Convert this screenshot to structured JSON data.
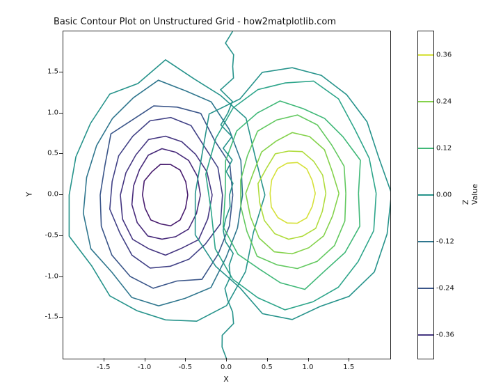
{
  "chart_data": {
    "type": "contour",
    "title": "Basic Contour Plot on Unstructured Grid - how2matplotlib.com",
    "xlabel": "X",
    "ylabel": "Y",
    "xlim": [
      -2.0,
      2.0
    ],
    "ylim": [
      -2.0,
      2.0
    ],
    "xticks": [
      -1.5,
      -1.0,
      -0.5,
      0.0,
      0.5,
      1.0,
      1.5
    ],
    "yticks": [
      -1.5,
      -1.0,
      -0.5,
      0.0,
      0.5,
      1.0,
      1.5
    ],
    "function": "z = sin(x) * cos(y) on [-2,2] x [-2,2] (unstructured / tricontour)",
    "levels": [
      -0.36,
      -0.24,
      -0.12,
      0.0,
      0.12,
      0.24,
      0.36
    ],
    "level_colors": [
      "#453681",
      "#3a5589",
      "#2f768e",
      "#26938b",
      "#3fb877",
      "#84d24b",
      "#d6e13a"
    ],
    "left_lobe": {
      "center": [
        -0.8,
        0.0
      ],
      "sign": "negative",
      "min_approx": -0.4
    },
    "right_lobe": {
      "center": [
        0.8,
        0.0
      ],
      "sign": "positive",
      "max_approx": 0.4
    },
    "colorbar": {
      "label": "Z Value",
      "ticks": [
        -0.36,
        -0.24,
        -0.12,
        0.0,
        0.12,
        0.24,
        0.36
      ],
      "range": [
        -0.42,
        0.42
      ]
    }
  }
}
